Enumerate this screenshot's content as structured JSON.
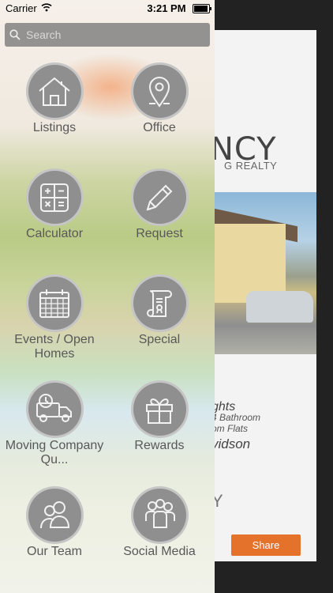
{
  "status_bar": {
    "carrier": "Carrier",
    "time": "3:21 PM"
  },
  "search": {
    "placeholder": "Search"
  },
  "menu": [
    {
      "label": "Listings",
      "icon": "home-icon"
    },
    {
      "label": "Office",
      "icon": "location-pin-icon"
    },
    {
      "label": "Calculator",
      "icon": "calculator-icon"
    },
    {
      "label": "Request",
      "icon": "pencil-icon"
    },
    {
      "label": "Events / Open Homes",
      "icon": "calendar-icon"
    },
    {
      "label": "Special",
      "icon": "certificate-scroll-icon"
    },
    {
      "label": "Moving Company Qu...",
      "icon": "moving-truck-icon"
    },
    {
      "label": "Rewards",
      "icon": "gift-icon"
    },
    {
      "label": "Our Team",
      "icon": "team-icon"
    },
    {
      "label": "Social Media",
      "icon": "social-people-icon"
    }
  ],
  "background": {
    "logo": "NCY",
    "logo_sub": "G REALTY",
    "text1": "ghts",
    "text2": "4 Bathroom",
    "text3": "om Flats",
    "text4": "vidson",
    "text5": "Y",
    "share_label": "Share"
  }
}
